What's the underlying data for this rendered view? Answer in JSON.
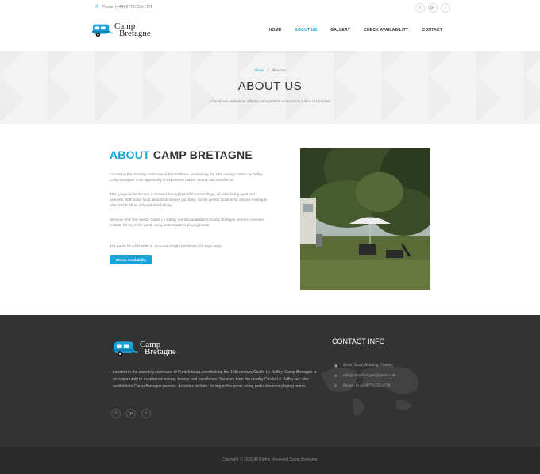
{
  "topbar": {
    "phone": "Phone: (+44) 0779-255-1778",
    "social": [
      "f",
      "g+",
      "t"
    ]
  },
  "brand": {
    "line1": "Camp",
    "line2": "Bretagne"
  },
  "nav": [
    {
      "label": "HOME",
      "active": false
    },
    {
      "label": "ABOUT US",
      "active": true
    },
    {
      "label": "GALLERY",
      "active": false
    },
    {
      "label": "CHECK AVAILABILITY",
      "active": false
    },
    {
      "label": "CONTACT",
      "active": false
    }
  ],
  "breadcrumb": {
    "home": "Home",
    "sep": "/",
    "current": "About us"
  },
  "page": {
    "title": "ABOUT US",
    "subtitle": "A family-run endeavour offering unforgettable moments in a slice of paradise."
  },
  "about": {
    "title_hl": "ABOUT",
    "title_rest": "CAMP BRETAGNE",
    "p1": "Located in the stunning commune of Pontchâteau, overlooking the 19th century Castle Le Daffey, Camp Bretagne is an opportunity to experience nature, beauty and excellence.",
    "p2": "This gorgeous landscape is situated among beautiful surroundings, all while being quiet and peaceful. With many local attractions to keep you busy, it's the perfect location for anyone looking to relax and build an unforgettable holiday.",
    "p3": "Services from the nearby Castle Le Daffey are also available to Camp Bretagne patrons. Activities include: fishing in the pond, using pedal boats or playing tennis.",
    "p4": "424 Euros for a full week or 75 Euros a night (minimum of 3 night stay).",
    "button": "Check Availability"
  },
  "footer": {
    "about": "Located in the stunning commune of Pontchâteau, overlooking the 19th century Castle Le Daffey, Camp Bretagne is an opportunity to experience nature, beauty and excellence. Services from the nearby Castle Le Daffey are also available to Camp Bretagne patrons. Activities include: fishing in the pond, using pedal-boats or playing tennis.",
    "social": [
      "f",
      "g+",
      "t"
    ],
    "contact_title": "CONTACT INFO",
    "address": "Street, Road, Building, Country",
    "email": "info@campbretagne@gmail.com",
    "phone": "Phone: (+44) 0779-255-1778",
    "copyright": "Copyright © 2015 All Rights Reserved Camp Bretagne."
  },
  "colors": {
    "accent": "#19a3d9",
    "footer_bg": "#333333",
    "copy_bg": "#2a2a2a"
  }
}
